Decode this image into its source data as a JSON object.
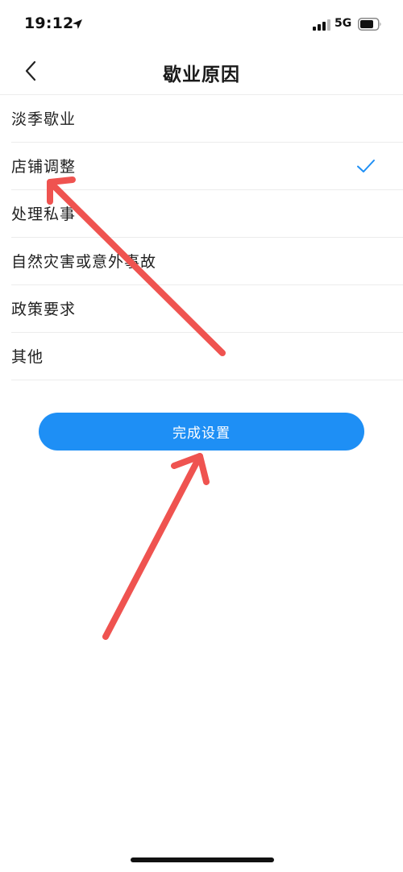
{
  "status_bar": {
    "time": "19:12",
    "network": "5G",
    "icons": [
      "location-arrow-icon",
      "signal-icon",
      "battery-icon"
    ]
  },
  "nav": {
    "title": "歇业原因",
    "back_icon": "chevron-left-icon"
  },
  "reasons": {
    "items": [
      {
        "label": "淡季歇业",
        "selected": false
      },
      {
        "label": "店铺调整",
        "selected": true
      },
      {
        "label": "处理私事",
        "selected": false
      },
      {
        "label": "自然灾害或意外事故",
        "selected": false
      },
      {
        "label": "政策要求",
        "selected": false
      },
      {
        "label": "其他",
        "selected": false
      }
    ],
    "check_icon": "checkmark-icon"
  },
  "actions": {
    "complete_label": "完成设置"
  },
  "colors": {
    "accent": "#1e8ff5",
    "check": "#1e8ff5",
    "annotation": "#ef5350",
    "divider": "#ececec"
  }
}
